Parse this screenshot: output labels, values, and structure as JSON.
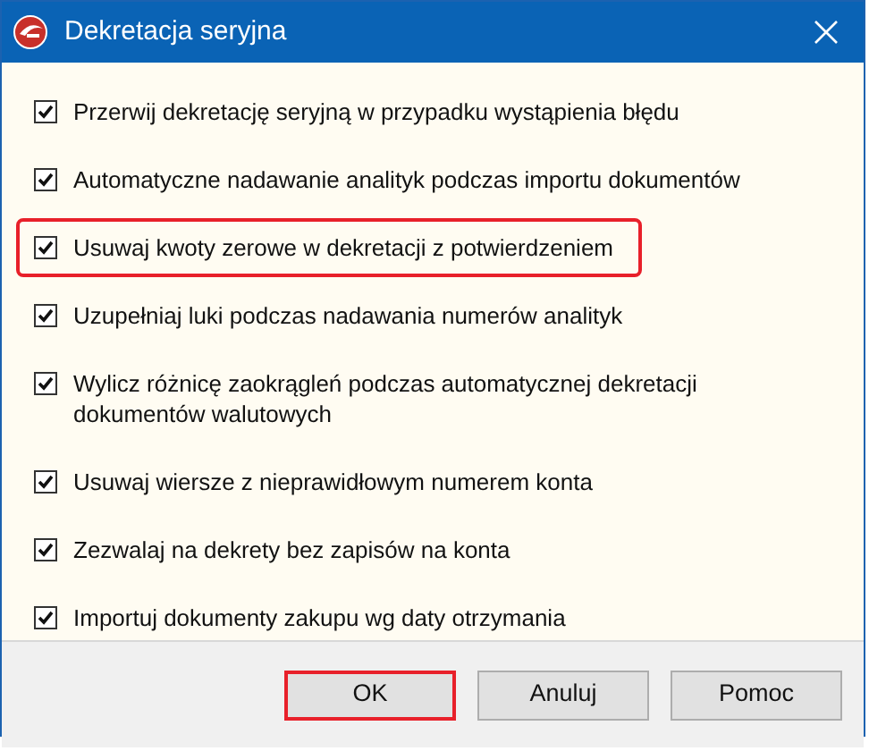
{
  "window": {
    "title": "Dekretacja seryjna"
  },
  "options": [
    {
      "label": "Przerwij dekretację seryjną w przypadku wystąpienia błędu",
      "checked": true,
      "highlighted": false
    },
    {
      "label": "Automatyczne nadawanie analityk podczas importu dokumentów",
      "checked": true,
      "highlighted": false
    },
    {
      "label": "Usuwaj kwoty zerowe w dekretacji z potwierdzeniem",
      "checked": true,
      "highlighted": true
    },
    {
      "label": "Uzupełniaj luki podczas nadawania numerów analityk",
      "checked": true,
      "highlighted": false
    },
    {
      "label": "Wylicz różnicę zaokrągleń podczas automatycznej dekretacji dokumentów walutowych",
      "checked": true,
      "highlighted": false
    },
    {
      "label": "Usuwaj wiersze z nieprawidłowym numerem konta",
      "checked": true,
      "highlighted": false
    },
    {
      "label": "Zezwalaj na dekrety bez zapisów na konta",
      "checked": true,
      "highlighted": false
    },
    {
      "label": "Importuj dokumenty zakupu wg daty otrzymania",
      "checked": true,
      "highlighted": false
    }
  ],
  "buttons": [
    {
      "label": "OK",
      "highlighted": true
    },
    {
      "label": "Anuluj",
      "highlighted": false
    },
    {
      "label": "Pomoc",
      "highlighted": false
    }
  ]
}
